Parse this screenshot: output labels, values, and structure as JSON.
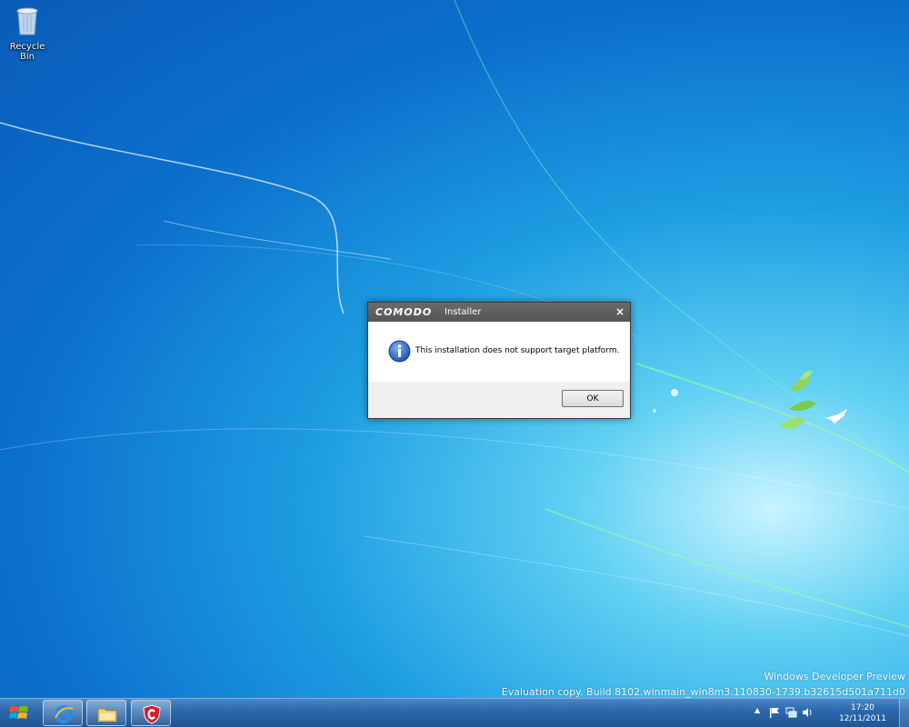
{
  "desktop": {
    "icons": [
      {
        "label": "Recycle Bin",
        "icon": "recycle-bin-icon"
      }
    ],
    "watermark": {
      "line1": "Windows Developer Preview",
      "line2": "Evaluation copy. Build 8102.winmain_win8m3.110830-1739.b32615d501a711d0"
    }
  },
  "dialog": {
    "brand": "COMODO",
    "title": "Installer",
    "close_label": "×",
    "icon": "info-icon",
    "message": "This installation does not support target platform.",
    "ok_label": "OK"
  },
  "taskbar": {
    "start_icon": "windows-logo-icon",
    "pinned": [
      {
        "name": "internet-explorer",
        "icon": "internet-explorer-icon"
      },
      {
        "name": "file-explorer",
        "icon": "folder-icon"
      },
      {
        "name": "comodo",
        "icon": "comodo-shield-icon"
      }
    ],
    "tray": {
      "icons": [
        "show-hidden-icons-icon",
        "action-center-flag-icon",
        "network-icon",
        "volume-icon"
      ],
      "show_hidden": "▲"
    },
    "clock": {
      "time": "17:20",
      "date": "12/11/2011"
    }
  },
  "colors": {
    "wallpaper_dark": "#0a5cb8",
    "wallpaper_light": "#c9f4ff",
    "dialog_titlebar": "#5a5a5a",
    "comodo_red": "#d4202c"
  }
}
